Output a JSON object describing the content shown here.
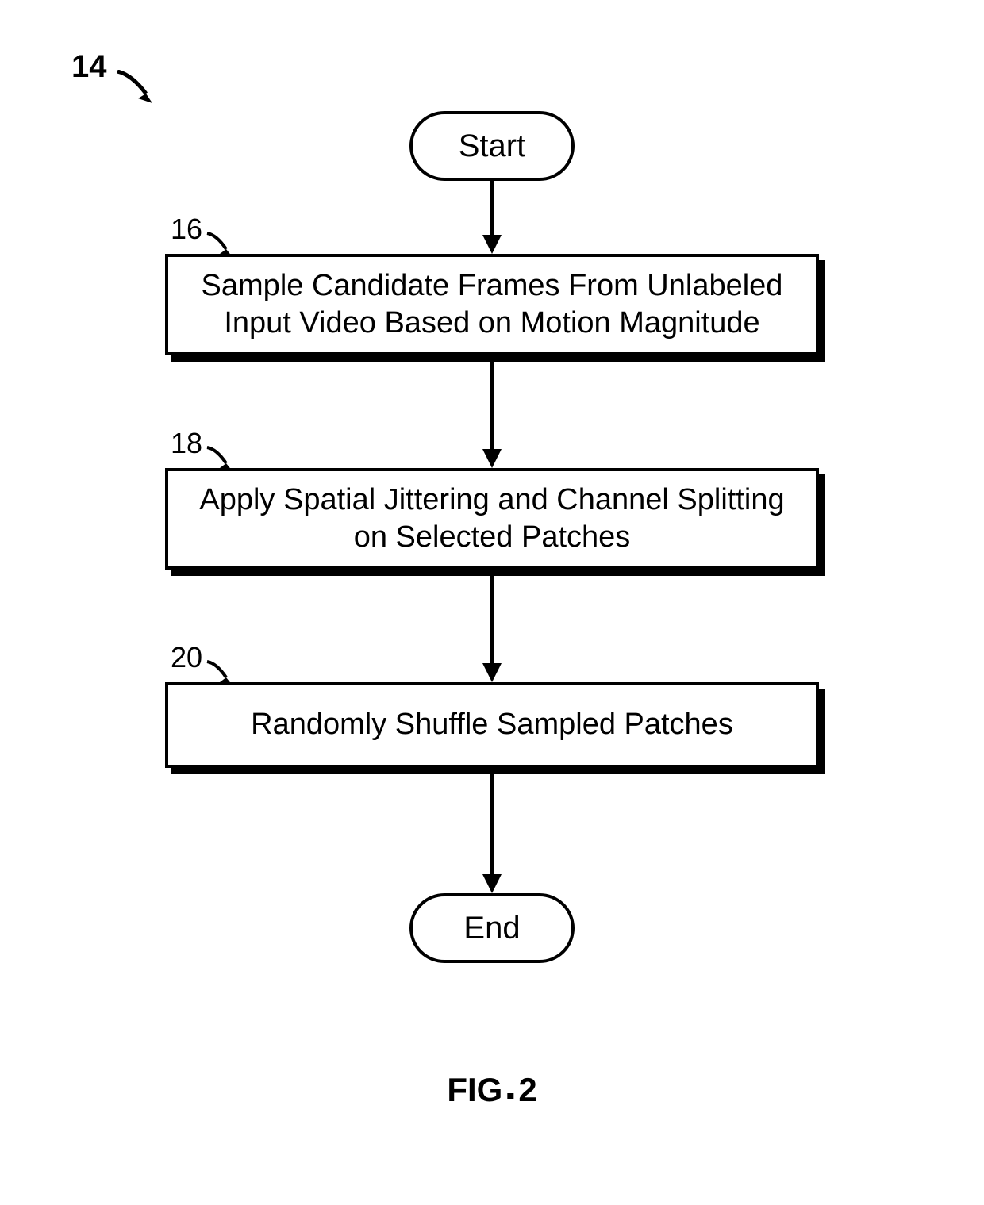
{
  "figure_ref": "14",
  "terminators": {
    "start": "Start",
    "end": "End"
  },
  "steps": [
    {
      "num": "16",
      "text": "Sample Candidate Frames From Unlabeled Input Video Based on Motion Magnitude"
    },
    {
      "num": "18",
      "text": "Apply Spatial Jittering and Channel Splitting on Selected Patches"
    },
    {
      "num": "20",
      "text": "Randomly Shuffle Sampled Patches"
    }
  ],
  "caption": {
    "prefix": "FIG",
    "number": "2"
  },
  "chart_data": {
    "type": "flowchart",
    "nodes": [
      {
        "id": "start",
        "shape": "terminator",
        "label": "Start"
      },
      {
        "id": "16",
        "shape": "process",
        "label": "Sample Candidate Frames From Unlabeled Input Video Based on Motion Magnitude"
      },
      {
        "id": "18",
        "shape": "process",
        "label": "Apply Spatial Jittering and Channel Splitting on Selected Patches"
      },
      {
        "id": "20",
        "shape": "process",
        "label": "Randomly Shuffle Sampled Patches"
      },
      {
        "id": "end",
        "shape": "terminator",
        "label": "End"
      }
    ],
    "edges": [
      {
        "from": "start",
        "to": "16"
      },
      {
        "from": "16",
        "to": "18"
      },
      {
        "from": "18",
        "to": "20"
      },
      {
        "from": "20",
        "to": "end"
      }
    ],
    "title": "FIG. 2",
    "reference_numeral": "14"
  }
}
